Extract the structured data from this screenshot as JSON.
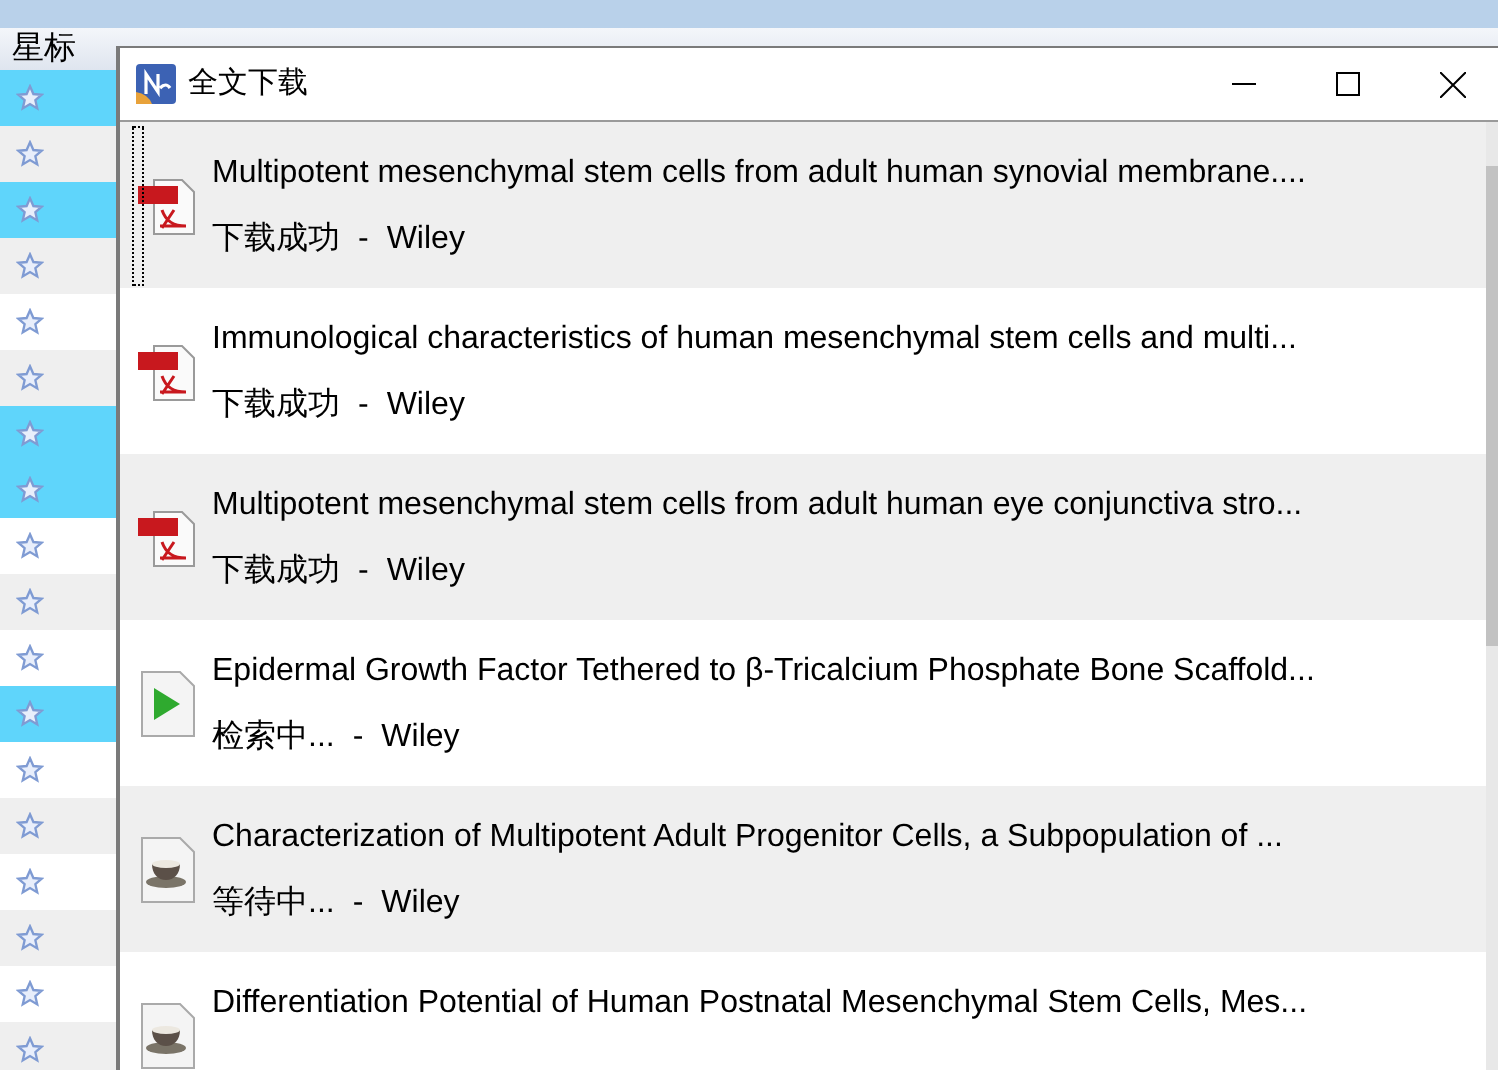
{
  "background_table": {
    "star_column_header": "星标",
    "rows": [
      {
        "selected": true
      },
      {
        "selected": false
      },
      {
        "selected": true
      },
      {
        "selected": false
      },
      {
        "selected": false
      },
      {
        "selected": false
      },
      {
        "selected": true
      },
      {
        "selected": true
      },
      {
        "selected": false
      },
      {
        "selected": false
      },
      {
        "selected": false
      },
      {
        "selected": true
      },
      {
        "selected": false
      },
      {
        "selected": false
      },
      {
        "selected": false
      },
      {
        "selected": false
      },
      {
        "selected": false
      },
      {
        "selected": false
      }
    ]
  },
  "dialog": {
    "title": "全文下载",
    "items": [
      {
        "kind": "pdf",
        "title": "Multipotent mesenchymal stem cells from adult human synovial membrane....",
        "status": "下载成功",
        "separator": "-",
        "source": "Wiley",
        "focused": true
      },
      {
        "kind": "pdf",
        "title": "Immunological characteristics of human mesenchymal stem cells and multi...",
        "status": "下载成功",
        "separator": "-",
        "source": "Wiley",
        "focused": false
      },
      {
        "kind": "pdf",
        "title": "Multipotent mesenchymal stem cells from adult human eye conjunctiva stro...",
        "status": "下载成功",
        "separator": "-",
        "source": "Wiley",
        "focused": false
      },
      {
        "kind": "searching",
        "title": "Epidermal Growth Factor Tethered to β-Tricalcium Phosphate Bone Scaffold...",
        "status": "检索中...",
        "separator": "-",
        "source": "Wiley",
        "focused": false
      },
      {
        "kind": "waiting",
        "title": "Characterization of Multipotent Adult Progenitor Cells, a Subpopulation of ...",
        "status": "等待中...",
        "separator": "-",
        "source": "Wiley",
        "focused": false
      },
      {
        "kind": "waiting",
        "title": "Differentiation Potential of Human Postnatal Mesenchymal Stem Cells, Mes...",
        "focused": false
      }
    ]
  }
}
